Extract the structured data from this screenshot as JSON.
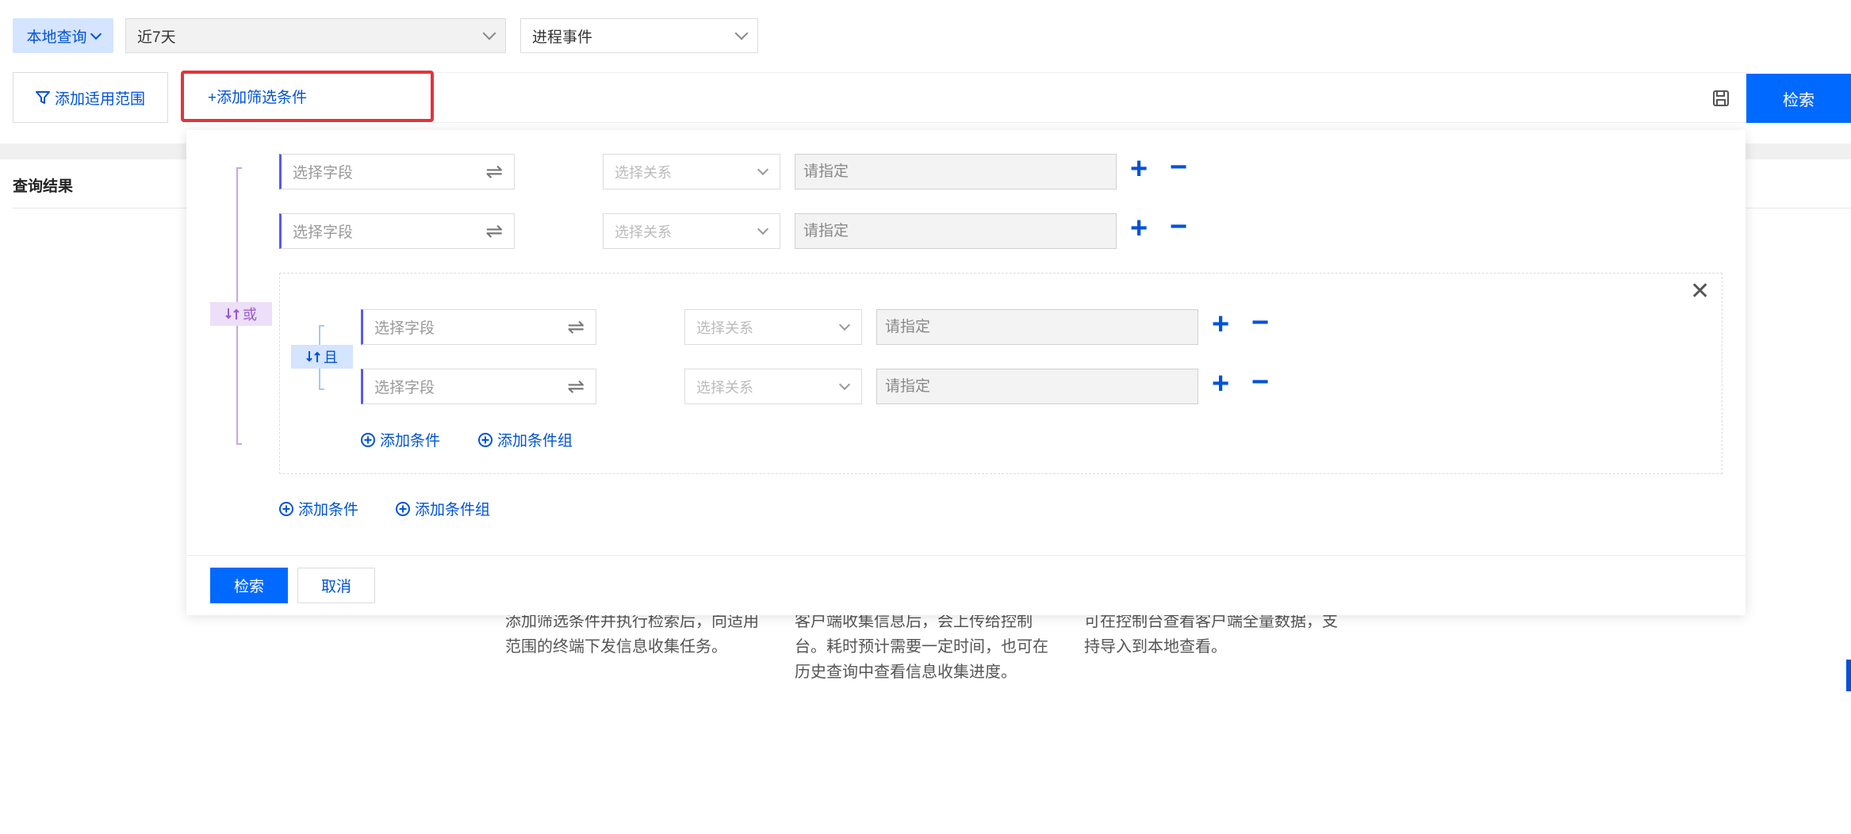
{
  "topbar": {
    "local_query": "本地查询",
    "time_range": "近7天",
    "event_type": "进程事件"
  },
  "filterbar": {
    "add_scope": "添加适用范围",
    "add_filter": "+添加筛选条件",
    "search": "检索"
  },
  "results": {
    "title": "查询结果",
    "desc1": "添加筛选条件并执行检索后，向适用范围的终端下发信息收集任务。",
    "desc2": "客户端收集信息后，会上传给控制台。耗时预计需要一定时间，也可在历史查询中查看信息收集进度。",
    "desc3": "可在控制台查看客户端全量数据，支持导入到本地查看。"
  },
  "panel": {
    "field_placeholder": "选择字段",
    "relation_placeholder": "选择关系",
    "value_placeholder": "请指定",
    "or_label": "或",
    "and_label": "且",
    "add_condition": "添加条件",
    "add_condition_group": "添加条件组",
    "search": "检索",
    "cancel": "取消"
  },
  "colors": {
    "primary": "#0069ff",
    "highlight_border": "#e3343b",
    "or_tag": "#9b59d0"
  },
  "icons": [
    "chevron-down-icon",
    "filter-icon",
    "save-icon",
    "swap-icon",
    "plus-icon",
    "minus-icon",
    "close-icon",
    "add-circle-icon",
    "toggle-logic-icon"
  ]
}
